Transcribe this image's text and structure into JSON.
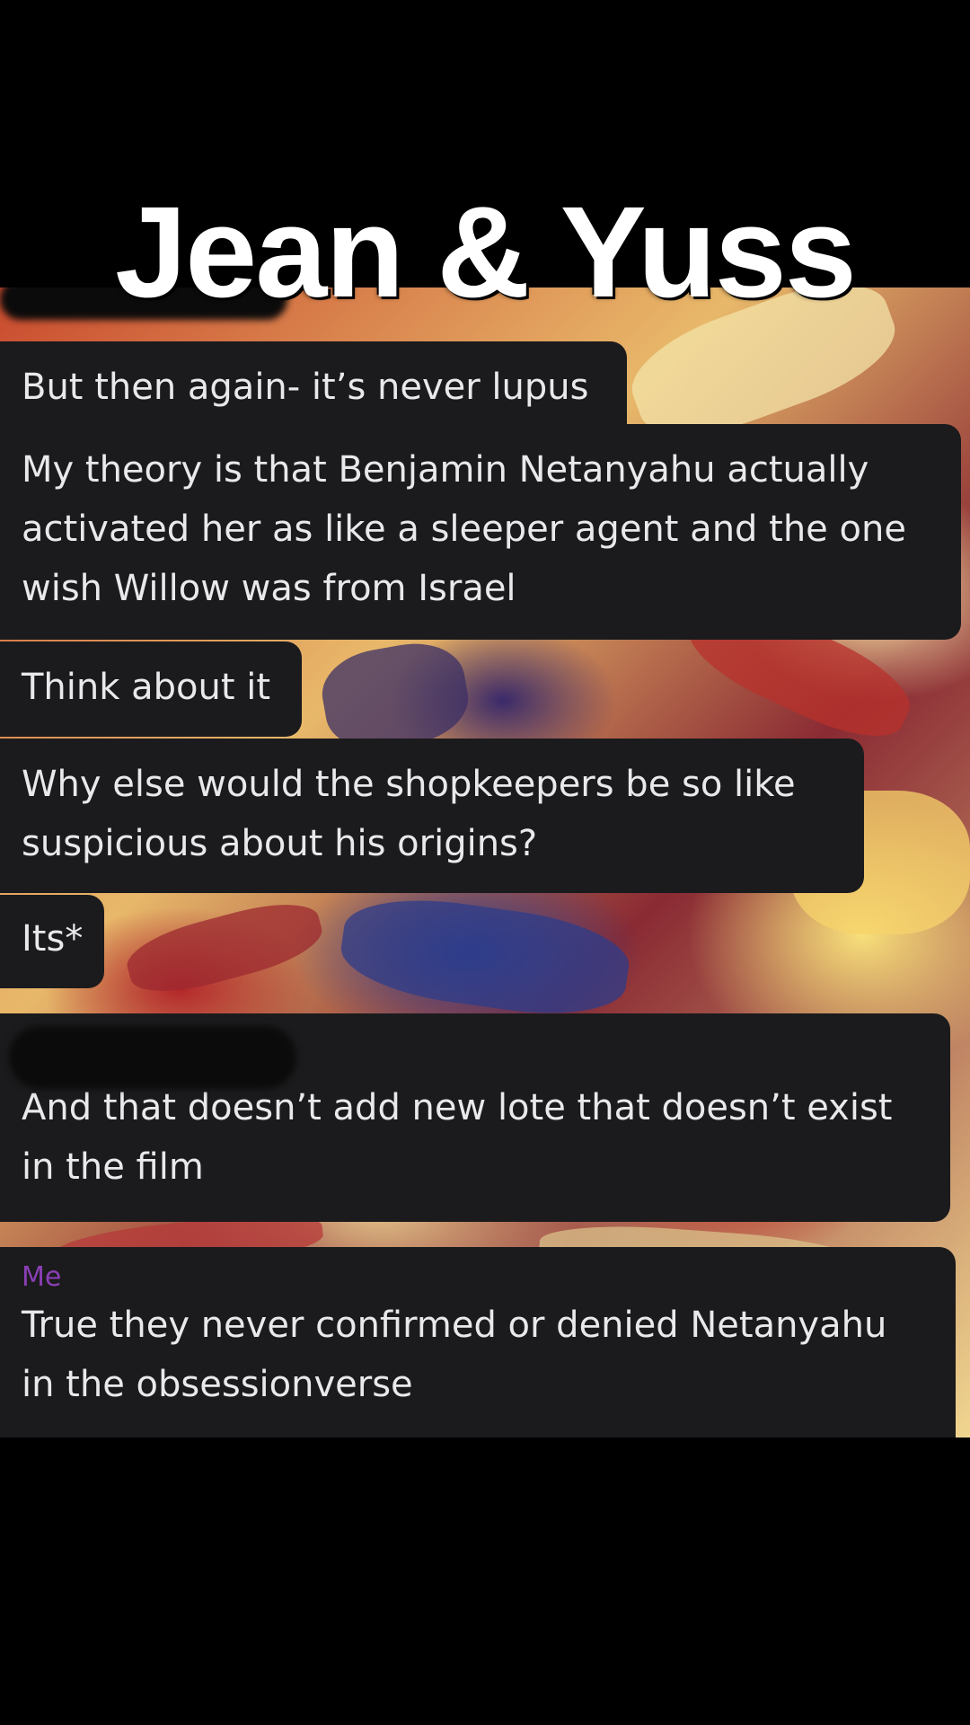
{
  "overlay_title": "Jean & Yuss",
  "messages": [
    {
      "sender": "",
      "lines": [
        "But then again- it’s never lupus"
      ]
    },
    {
      "sender": "",
      "lines": [
        "My theory is that Benjamin Netanyahu actually",
        "activated her as like a sleeper agent and the one",
        "wish Willow was from Israel"
      ]
    },
    {
      "sender": "",
      "lines": [
        "Think about it"
      ]
    },
    {
      "sender": "",
      "lines": [
        "Why else would the shopkeepers be so like",
        "suspicious about his origins?"
      ]
    },
    {
      "sender": "",
      "lines": [
        "Its*"
      ]
    },
    {
      "sender": "",
      "lines": [
        "And that doesn’t add new lote that doesn’t exist",
        "in the film"
      ]
    },
    {
      "sender": "Me",
      "lines": [
        "True they never confirmed or denied Netanyahu",
        "in the obsessionverse"
      ]
    }
  ],
  "colors": {
    "background": "#000000",
    "bubble": "#1b1b1d",
    "bubble_text": "#e9e9eb",
    "me_sender": "#8a3fb4",
    "title_text": "#ffffff"
  }
}
